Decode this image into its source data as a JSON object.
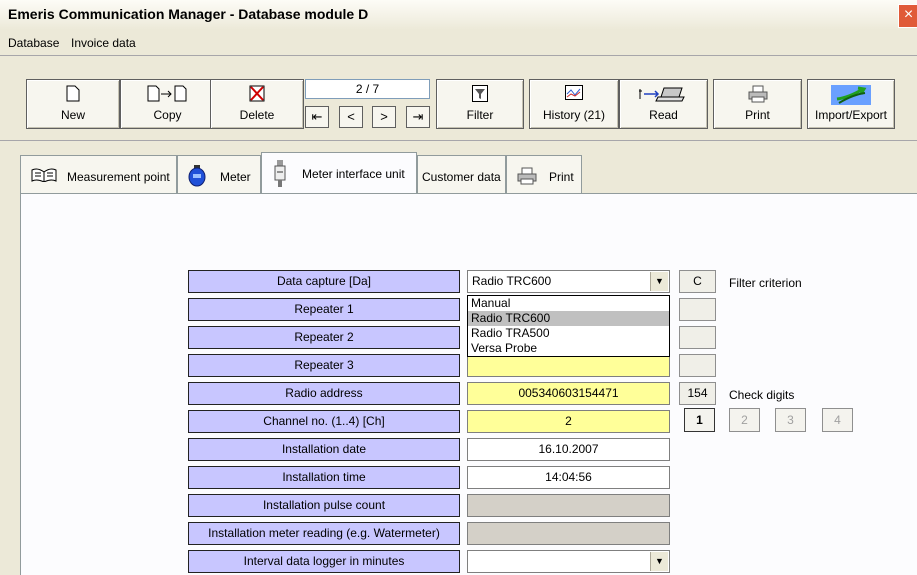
{
  "window": {
    "title": "Emeris Communication Manager - Database module D",
    "close": "×"
  },
  "menu": [
    "Database",
    "Invoice data"
  ],
  "toolbar": {
    "new": "New",
    "copy": "Copy",
    "delete": "Delete",
    "record_counter": "2 / 7",
    "nav": [
      "⇤",
      "<",
      ">",
      "⇥"
    ],
    "filter": "Filter",
    "history": "History (21)",
    "read": "Read",
    "print": "Print",
    "import_export": "Import/Export"
  },
  "tabs": [
    "Measurement point",
    "Meter",
    "Meter interface unit",
    "Customer data",
    "Print"
  ],
  "form": {
    "labels": [
      "Data capture  [Da]",
      "Repeater 1",
      "Repeater 2",
      "Repeater 3",
      "Radio address",
      "Channel no. (1..4)  [Ch]",
      "Installation date",
      "Installation time",
      "Installation pulse count",
      "Installation meter reading (e.g. Watermeter)",
      "Interval data logger in minutes"
    ],
    "data_capture_value": "Radio TRC600",
    "dropdown_options": [
      "Manual",
      "Radio TRC600",
      "Radio TRA500",
      "Versa Probe"
    ],
    "dropdown_selected": "Radio TRC600",
    "radio_address": "005340603154471",
    "channel_no": "2",
    "installation_date": "16.10.2007",
    "installation_time": "14:04:56",
    "filter_code": "C",
    "filter_label": "Filter criterion",
    "check_digits_value": "154",
    "check_digits_label": "Check digits",
    "channel_buttons": [
      "1",
      "2",
      "3",
      "4"
    ],
    "channel_active": "1"
  }
}
